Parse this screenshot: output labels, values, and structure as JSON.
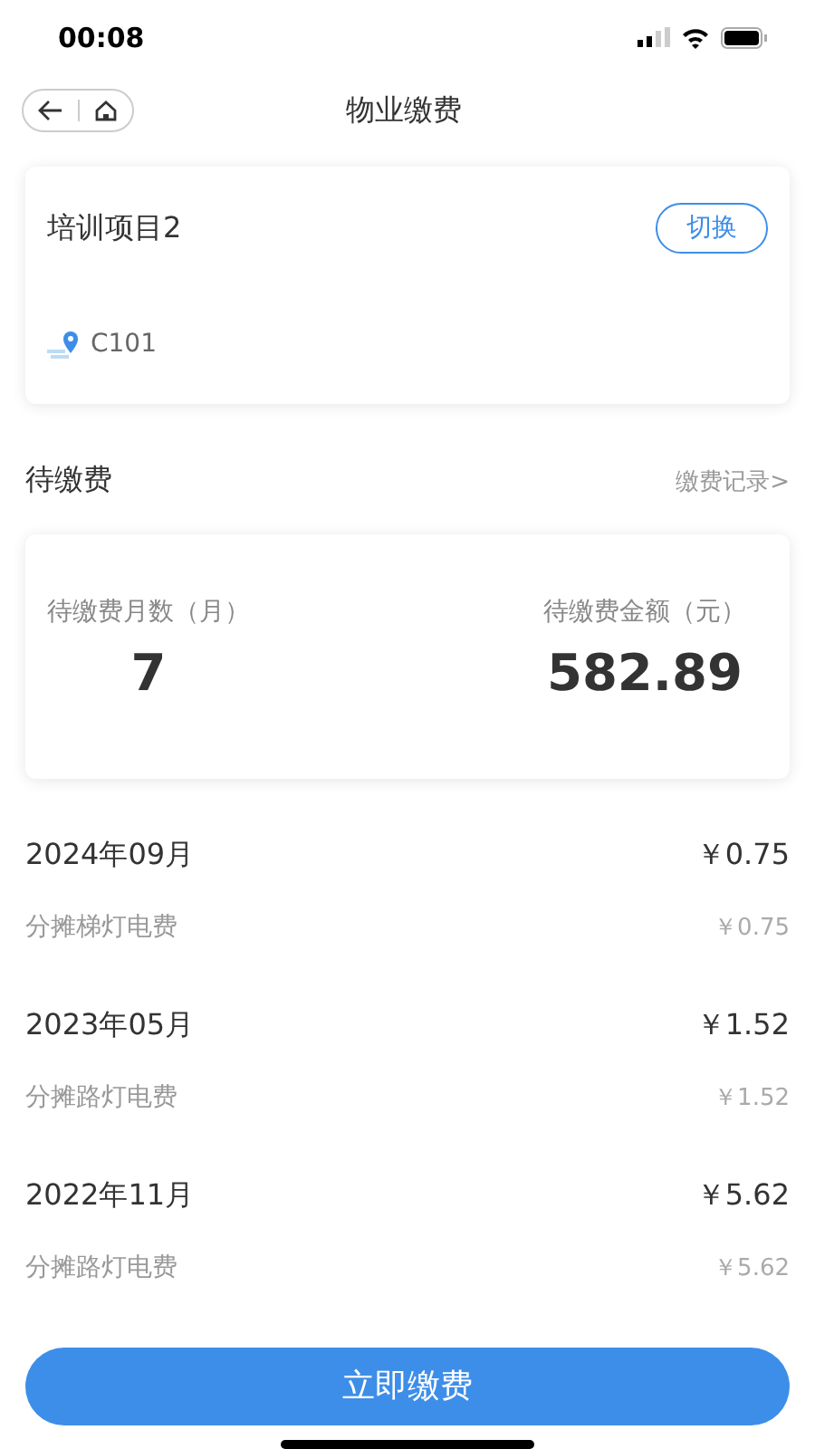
{
  "status_bar": {
    "time": "00:08"
  },
  "nav": {
    "title": "物业缴费"
  },
  "project": {
    "name": "培训项目2",
    "switch_label": "切换",
    "room": "C101"
  },
  "section": {
    "title": "待缴费",
    "link": "缴费记录>"
  },
  "summary": [
    {
      "label": "待缴费月数（月）",
      "value": "7"
    },
    {
      "label": "待缴费金额（元）",
      "value": "582.89"
    }
  ],
  "bills": [
    {
      "month": "2024年09月",
      "total": "￥0.75",
      "items": [
        {
          "name": "分摊梯灯电费",
          "amount": "￥0.75"
        }
      ]
    },
    {
      "month": "2023年05月",
      "total": "￥1.52",
      "items": [
        {
          "name": "分摊路灯电费",
          "amount": "￥1.52"
        }
      ]
    },
    {
      "month": "2022年11月",
      "total": "￥5.62",
      "items": [
        {
          "name": "分摊路灯电费",
          "amount": "￥5.62"
        }
      ]
    }
  ],
  "pay_button": "立即缴费"
}
